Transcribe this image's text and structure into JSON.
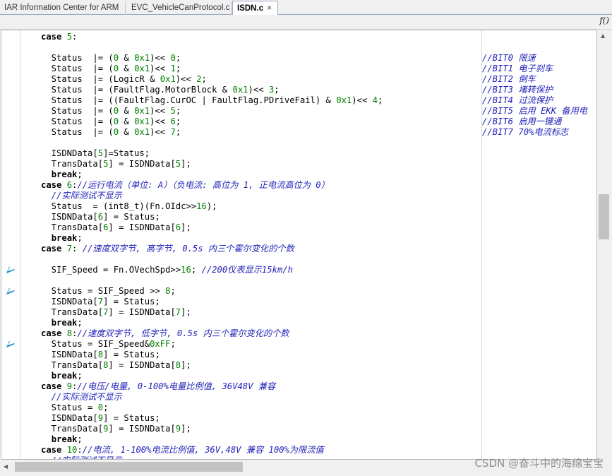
{
  "tabs": [
    {
      "label": "IAR Information Center for ARM",
      "active": false
    },
    {
      "label": "EVC_VehicleCanProtocol.c",
      "active": false
    },
    {
      "label": "ISDN.c",
      "active": true,
      "close": "×"
    }
  ],
  "toolbar": {
    "function_icon": "f()"
  },
  "watermark": "CSDN @奋斗中的海绵宝宝",
  "colors": {
    "keyword": "#000000",
    "number": "#008000",
    "comment": "#1f1fb8",
    "bookmark": "#1b8fd0"
  },
  "lines": [
    {
      "segs": [
        [
          "kw",
          "case "
        ],
        [
          "num",
          "5"
        ],
        [
          "p",
          ":"
        ]
      ]
    },
    {
      "segs": []
    },
    {
      "segs": [
        [
          "p",
          "  Status  |= ("
        ],
        [
          "num",
          "0"
        ],
        [
          "p",
          " & "
        ],
        [
          "num",
          "0x1"
        ],
        [
          "p",
          ")<< "
        ],
        [
          "num",
          "0"
        ],
        [
          "p",
          ";"
        ]
      ],
      "rc": "//BIT0 限速"
    },
    {
      "segs": [
        [
          "p",
          "  Status  |= ("
        ],
        [
          "num",
          "0"
        ],
        [
          "p",
          " & "
        ],
        [
          "num",
          "0x1"
        ],
        [
          "p",
          ")<< "
        ],
        [
          "num",
          "1"
        ],
        [
          "p",
          ";"
        ]
      ],
      "rc": "//BIT1 电子刹车"
    },
    {
      "segs": [
        [
          "p",
          "  Status  |= (LogicR & "
        ],
        [
          "num",
          "0x1"
        ],
        [
          "p",
          ")<< "
        ],
        [
          "num",
          "2"
        ],
        [
          "p",
          ";"
        ]
      ],
      "rc": "//BIT2 倒车"
    },
    {
      "segs": [
        [
          "p",
          "  Status  |= (FaultFlag.MotorBlock & "
        ],
        [
          "num",
          "0x1"
        ],
        [
          "p",
          ")<< "
        ],
        [
          "num",
          "3"
        ],
        [
          "p",
          ";"
        ]
      ],
      "rc": "//BIT3 堵转保护"
    },
    {
      "segs": [
        [
          "p",
          "  Status  |= ((FaultFlag.CurOC | FaultFlag.PDriveFail) & "
        ],
        [
          "num",
          "0x1"
        ],
        [
          "p",
          ")<< "
        ],
        [
          "num",
          "4"
        ],
        [
          "p",
          ";"
        ]
      ],
      "rc": "//BIT4 过流保护"
    },
    {
      "segs": [
        [
          "p",
          "  Status  |= ("
        ],
        [
          "num",
          "0"
        ],
        [
          "p",
          " & "
        ],
        [
          "num",
          "0x1"
        ],
        [
          "p",
          ")<< "
        ],
        [
          "num",
          "5"
        ],
        [
          "p",
          ";"
        ]
      ],
      "rc": "//BIT5 启用 EKK 备用电"
    },
    {
      "segs": [
        [
          "p",
          "  Status  |= ("
        ],
        [
          "num",
          "0"
        ],
        [
          "p",
          " & "
        ],
        [
          "num",
          "0x1"
        ],
        [
          "p",
          ")<< "
        ],
        [
          "num",
          "6"
        ],
        [
          "p",
          ";"
        ]
      ],
      "rc": "//BIT6 启用一键通"
    },
    {
      "segs": [
        [
          "p",
          "  Status  |= ("
        ],
        [
          "num",
          "0"
        ],
        [
          "p",
          " & "
        ],
        [
          "num",
          "0x1"
        ],
        [
          "p",
          ")<< "
        ],
        [
          "num",
          "7"
        ],
        [
          "p",
          ";"
        ]
      ],
      "rc": "//BIT7 70%电流标志"
    },
    {
      "segs": []
    },
    {
      "segs": [
        [
          "p",
          "  ISDNData["
        ],
        [
          "num",
          "5"
        ],
        [
          "p",
          "]=Status;"
        ]
      ]
    },
    {
      "segs": [
        [
          "p",
          "  TransData["
        ],
        [
          "num",
          "5"
        ],
        [
          "p",
          "] = ISDNData["
        ],
        [
          "num",
          "5"
        ],
        [
          "p",
          "];"
        ]
      ]
    },
    {
      "segs": [
        [
          "p",
          "  "
        ],
        [
          "kw",
          "break"
        ],
        [
          "p",
          ";"
        ]
      ]
    },
    {
      "segs": [
        [
          "kw",
          "case "
        ],
        [
          "num",
          "6"
        ],
        [
          "p",
          ":"
        ],
        [
          "cmt",
          "//运行电流（单位: A）（负电流: 高位为 1, 正电流高位为 0）"
        ]
      ]
    },
    {
      "segs": [
        [
          "cmt",
          "  //实际测试不显示"
        ]
      ]
    },
    {
      "segs": [
        [
          "p",
          "  Status  = (int8_t)(Fn.OIdc>>"
        ],
        [
          "num",
          "16"
        ],
        [
          "p",
          ");"
        ]
      ]
    },
    {
      "segs": [
        [
          "p",
          "  ISDNData["
        ],
        [
          "num",
          "6"
        ],
        [
          "p",
          "] = Status;"
        ]
      ]
    },
    {
      "segs": [
        [
          "p",
          "  TransData["
        ],
        [
          "num",
          "6"
        ],
        [
          "p",
          "] = ISDNData["
        ],
        [
          "num",
          "6"
        ],
        [
          "p",
          "];"
        ]
      ]
    },
    {
      "segs": [
        [
          "p",
          "  "
        ],
        [
          "kw",
          "break"
        ],
        [
          "p",
          ";"
        ]
      ]
    },
    {
      "segs": [
        [
          "kw",
          "case "
        ],
        [
          "num",
          "7"
        ],
        [
          "p",
          ": "
        ],
        [
          "cmt",
          "//速度双字节, 高字节, 0.5s 内三个霍尔变化的个数"
        ]
      ]
    },
    {
      "segs": []
    },
    {
      "segs": [
        [
          "p",
          "  SIF_Speed = Fn.OVechSpd>>"
        ],
        [
          "num",
          "16"
        ],
        [
          "p",
          "; "
        ],
        [
          "cmt",
          "//200仪表显示15km/h"
        ]
      ],
      "bm": true
    },
    {
      "segs": []
    },
    {
      "segs": [
        [
          "p",
          "  Status = SIF_Speed >> "
        ],
        [
          "num",
          "8"
        ],
        [
          "p",
          ";"
        ]
      ],
      "bm": true
    },
    {
      "segs": [
        [
          "p",
          "  ISDNData["
        ],
        [
          "num",
          "7"
        ],
        [
          "p",
          "] = Status;"
        ]
      ]
    },
    {
      "segs": [
        [
          "p",
          "  TransData["
        ],
        [
          "num",
          "7"
        ],
        [
          "p",
          "] = ISDNData["
        ],
        [
          "num",
          "7"
        ],
        [
          "p",
          "];"
        ]
      ]
    },
    {
      "segs": [
        [
          "p",
          "  "
        ],
        [
          "kw",
          "break"
        ],
        [
          "p",
          ";"
        ]
      ]
    },
    {
      "segs": [
        [
          "kw",
          "case "
        ],
        [
          "num",
          "8"
        ],
        [
          "p",
          ":"
        ],
        [
          "cmt",
          "//速度双字节, 低字节, 0.5s 内三个霍尔变化的个数"
        ]
      ]
    },
    {
      "segs": [
        [
          "p",
          "  Status = SIF_Speed&"
        ],
        [
          "num",
          "0xFF"
        ],
        [
          "p",
          ";"
        ]
      ],
      "bm": true
    },
    {
      "segs": [
        [
          "p",
          "  ISDNData["
        ],
        [
          "num",
          "8"
        ],
        [
          "p",
          "] = Status;"
        ]
      ]
    },
    {
      "segs": [
        [
          "p",
          "  TransData["
        ],
        [
          "num",
          "8"
        ],
        [
          "p",
          "] = ISDNData["
        ],
        [
          "num",
          "8"
        ],
        [
          "p",
          "];"
        ]
      ]
    },
    {
      "segs": [
        [
          "p",
          "  "
        ],
        [
          "kw",
          "break"
        ],
        [
          "p",
          ";"
        ]
      ]
    },
    {
      "segs": [
        [
          "kw",
          "case "
        ],
        [
          "num",
          "9"
        ],
        [
          "p",
          ":"
        ],
        [
          "cmt",
          "//电压/电量, 0-100%电量比例值, 36V48V 兼容"
        ]
      ]
    },
    {
      "segs": [
        [
          "cmt",
          "  //实际测试不显示"
        ]
      ]
    },
    {
      "segs": [
        [
          "p",
          "  Status = "
        ],
        [
          "num",
          "0"
        ],
        [
          "p",
          ";"
        ]
      ]
    },
    {
      "segs": [
        [
          "p",
          "  ISDNData["
        ],
        [
          "num",
          "9"
        ],
        [
          "p",
          "] = Status;"
        ]
      ]
    },
    {
      "segs": [
        [
          "p",
          "  TransData["
        ],
        [
          "num",
          "9"
        ],
        [
          "p",
          "] = ISDNData["
        ],
        [
          "num",
          "9"
        ],
        [
          "p",
          "];"
        ]
      ]
    },
    {
      "segs": [
        [
          "p",
          "  "
        ],
        [
          "kw",
          "break"
        ],
        [
          "p",
          ";"
        ]
      ]
    },
    {
      "segs": [
        [
          "kw",
          "case "
        ],
        [
          "num",
          "10"
        ],
        [
          "p",
          ":"
        ],
        [
          "cmt",
          "//电流, 1-100%电流比例值, 36V,48V 兼容 100%为限流值"
        ]
      ]
    },
    {
      "segs": [
        [
          "cmt",
          "  //实际测试不显示"
        ]
      ]
    }
  ]
}
